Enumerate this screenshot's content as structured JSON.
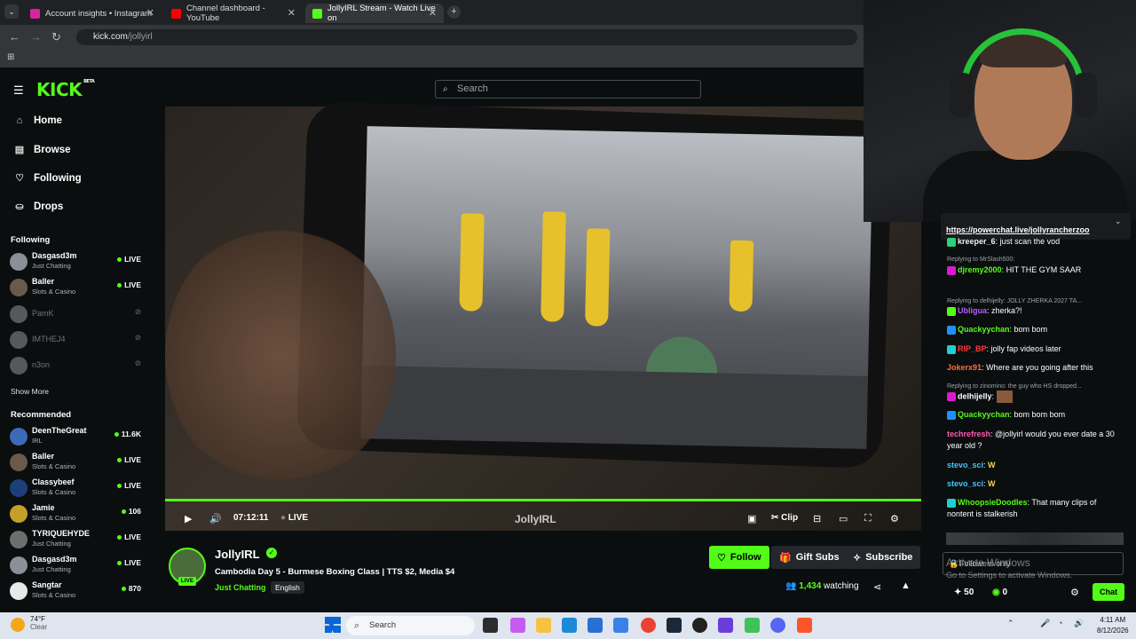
{
  "browser": {
    "tabs": [
      {
        "title": "Account insights • Instagram",
        "color": "#d6249f"
      },
      {
        "title": "Channel dashboard - YouTube",
        "color": "#ff0000"
      },
      {
        "title": "JollyIRL Stream - Watch Live on",
        "color": "#53fc18"
      }
    ],
    "url_host": "kick.com",
    "url_path": "/jollyirl"
  },
  "kick": {
    "logo": "KICK",
    "logo_tag": "BETA",
    "search_placeholder": "Search",
    "nav": [
      {
        "label": "Home",
        "icon": "home-icon"
      },
      {
        "label": "Browse",
        "icon": "browse-icon"
      },
      {
        "label": "Following",
        "icon": "heart-icon"
      },
      {
        "label": "Drops",
        "icon": "drops-icon"
      }
    ],
    "following_title": "Following",
    "following": [
      {
        "name": "Dasgasd3m",
        "category": "Just Chatting",
        "status": "LIVE",
        "live": true,
        "color": "#8b8f98"
      },
      {
        "name": "Baller",
        "category": "Slots & Casino",
        "status": "LIVE",
        "live": true,
        "color": "#6b5a4a"
      },
      {
        "name": "PamK",
        "category": "",
        "status": "",
        "live": false,
        "color": "#55585c"
      },
      {
        "name": "IMTHEJ4",
        "category": "",
        "status": "",
        "live": false,
        "color": "#55585c"
      },
      {
        "name": "n3on",
        "category": "",
        "status": "",
        "live": false,
        "color": "#55585c"
      }
    ],
    "show_more": "Show More",
    "recommended_title": "Recommended",
    "recommended": [
      {
        "name": "DeenTheGreat",
        "category": "IRL",
        "status": "11.6K",
        "color": "#3d6ab8"
      },
      {
        "name": "Baller",
        "category": "Slots & Casino",
        "status": "LIVE",
        "color": "#6b5a4a"
      },
      {
        "name": "Classybeef",
        "category": "Slots & Casino",
        "status": "LIVE",
        "color": "#1c3f7a"
      },
      {
        "name": "Jamie",
        "category": "Slots & Casino",
        "status": "106",
        "color": "#c4a02a"
      },
      {
        "name": "TYRIQUEHYDE",
        "category": "Just Chatting",
        "status": "LIVE",
        "color": "#6e6e6e"
      },
      {
        "name": "Dasgasd3m",
        "category": "Just Chatting",
        "status": "LIVE",
        "color": "#8b8f98"
      },
      {
        "name": "Sangtar",
        "category": "Slots & Casino",
        "status": "870",
        "color": "#e8e8e8"
      }
    ]
  },
  "player": {
    "time": "07:12:11",
    "live": "LIVE",
    "clip": "Clip",
    "watermark": "JollyIRL"
  },
  "stream": {
    "streamer": "JollyIRL",
    "live_badge": "LIVE",
    "title": "Cambodia Day 5 - Burmese Boxing Class | TTS $2, Media $4",
    "category": "Just Chatting",
    "language": "English",
    "follow": "Follow",
    "gift_subs": "Gift Subs",
    "subscribe": "Subscribe",
    "viewers": "1,434",
    "watching_label": "watching"
  },
  "chat": {
    "pinned_link": "https://powerchat.live/jollyrancherzoo",
    "messages": [
      {
        "user": "kreeper_6",
        "text": "just scan the vod",
        "color": "#f0f0f0",
        "badge": "#2ad17a"
      },
      {
        "reply": "Replying to MrSlash500:"
      },
      {
        "user": "djremy2000",
        "text": "HIT THE GYM SAAR",
        "color": "#53fc18",
        "badge": "#d81bce"
      },
      {
        "reply": "Replying to delhijelly: JOLLY ZHERKA 2027 TA..."
      },
      {
        "user": "Ubligua",
        "text": "zherka?!",
        "color": "#b45cff",
        "badge": "#53fc18"
      },
      {
        "user": "Quackyychan",
        "text": "bom bom",
        "color": "#53fc18",
        "badge": "#1e90ff"
      },
      {
        "user": "RIP_BP",
        "text": "jolly fap videos later",
        "color": "#ff3b3b",
        "badge": "#1ecfcf"
      },
      {
        "user": "Jokerx91",
        "text": "Where are you going after this",
        "color": "#ff6b3d",
        "badge": ""
      },
      {
        "reply": "Replying to zinomino: the guy who HS dropped..."
      },
      {
        "user": "delhijelly",
        "text": "",
        "color": "#ffffff",
        "badge": "#d81bce"
      },
      {
        "user": "Quackyychan",
        "text": "bom bom bom",
        "color": "#53fc18",
        "badge": "#1e90ff"
      },
      {
        "user": "techrefresh",
        "text": "@jollyirl would you ever date a 30 year old ?",
        "color": "#ff5bb0",
        "badge": ""
      },
      {
        "user": "stevo_sci",
        "text": "W",
        "color": "#3fc7ff",
        "badge": ""
      },
      {
        "user": "stevo_sci",
        "text": "W",
        "color": "#3fc7ff",
        "badge": ""
      },
      {
        "user": "WhoopsieDoodles",
        "text": "That many clips of nontent is stalkerish",
        "color": "#53fc18",
        "badge": "#1ecfcf"
      }
    ],
    "input_placeholder": "Followers only",
    "points": "50",
    "points2": "0",
    "send": "Chat",
    "activate_title": "Activate Windows",
    "activate_sub": "Go to Settings to activate Windows."
  },
  "taskbar": {
    "temp": "74°F",
    "weather": "Clear",
    "search": "Search",
    "time": "4:11 AM",
    "date": "8/12/2026"
  }
}
